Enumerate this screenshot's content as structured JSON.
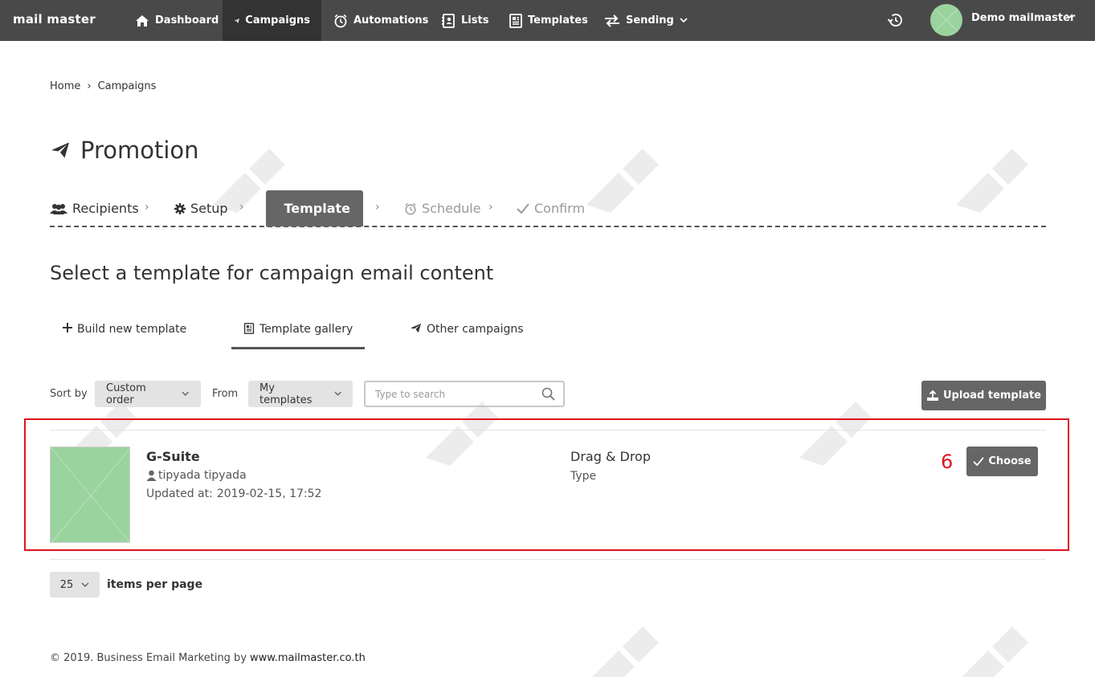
{
  "app": {
    "logo": "mail master"
  },
  "nav": {
    "items": [
      {
        "label": "Dashboard",
        "icon": "home-icon"
      },
      {
        "label": "Campaigns",
        "icon": "paper-plane-icon",
        "active": true
      },
      {
        "label": "Automations",
        "icon": "alarm-clock-icon"
      },
      {
        "label": "Lists",
        "icon": "contacts-book-icon"
      },
      {
        "label": "Templates",
        "icon": "newspaper-icon"
      },
      {
        "label": "Sending",
        "icon": "exchange-arrows-icon",
        "has_caret": true
      }
    ],
    "user_name": "Demo mailmaster"
  },
  "breadcrumb": {
    "home": "Home",
    "separator": "›",
    "current": "Campaigns"
  },
  "page": {
    "title": "Promotion"
  },
  "steps": [
    {
      "label": "Recipients",
      "state": "done"
    },
    {
      "label": "Setup",
      "state": "done"
    },
    {
      "label": "Template",
      "state": "active"
    },
    {
      "label": "Schedule",
      "state": "pending"
    },
    {
      "label": "Confirm",
      "state": "pending"
    }
  ],
  "step_separator": "›",
  "section": {
    "title": "Select a template for campaign email content"
  },
  "tabs": [
    {
      "label": "Build new template",
      "icon": "plus-icon"
    },
    {
      "label": "Template gallery",
      "icon": "newspaper-icon",
      "active": true
    },
    {
      "label": "Other campaigns",
      "icon": "paper-plane-icon"
    }
  ],
  "filters": {
    "sort_label": "Sort by",
    "sort_value": "Custom order",
    "from_label": "From",
    "from_value": "My templates",
    "search_placeholder": "Type to search",
    "upload_label": "Upload template"
  },
  "templates": [
    {
      "name": "G-Suite",
      "author": "tipyada tipyada",
      "updated_label": "Updated at:",
      "updated_value": "2019-02-15, 17:52",
      "type_value": "Drag & Drop",
      "type_label": "Type",
      "choose_label": "Choose"
    }
  ],
  "annotation": {
    "number": "6",
    "color": "#e0141e"
  },
  "pagination": {
    "per_page_value": "25",
    "per_page_label": "items per page"
  },
  "footer": {
    "text": "© 2019. Business Email Marketing by",
    "link": "www.mailmaster.co.th"
  },
  "colors": {
    "nav_bg": "#494949",
    "nav_active": "#333333",
    "button": "#666666",
    "thumb": "#9ad39e"
  }
}
